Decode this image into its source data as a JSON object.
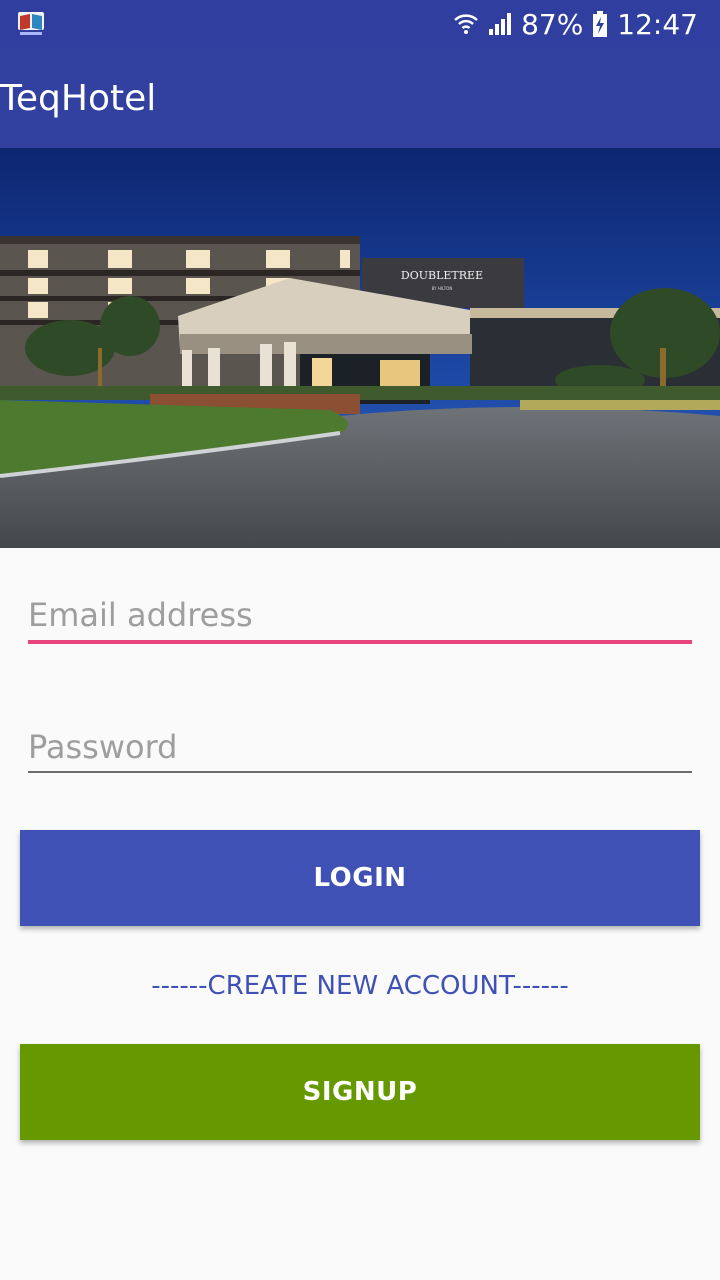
{
  "status_bar": {
    "battery": "87%",
    "time": "12:47",
    "icons": [
      "wifi-icon",
      "signal-icon",
      "battery-charging-icon"
    ]
  },
  "app_bar": {
    "title": "TeqHotel"
  },
  "hero_image": {
    "sign_text": "DOUBLETREE",
    "sign_subtext": "BY HILTON"
  },
  "form": {
    "email_placeholder": "Email address",
    "password_placeholder": "Password"
  },
  "buttons": {
    "login_label": "LOGIN",
    "create_account_text": "------CREATE NEW ACCOUNT------",
    "signup_label": "SIGNUP"
  },
  "colors": {
    "status_bar": "#303f9f",
    "app_bar": "#3240a0",
    "login_button": "#3f51b5",
    "signup_button": "#669900",
    "email_underline": "#e8457e"
  }
}
